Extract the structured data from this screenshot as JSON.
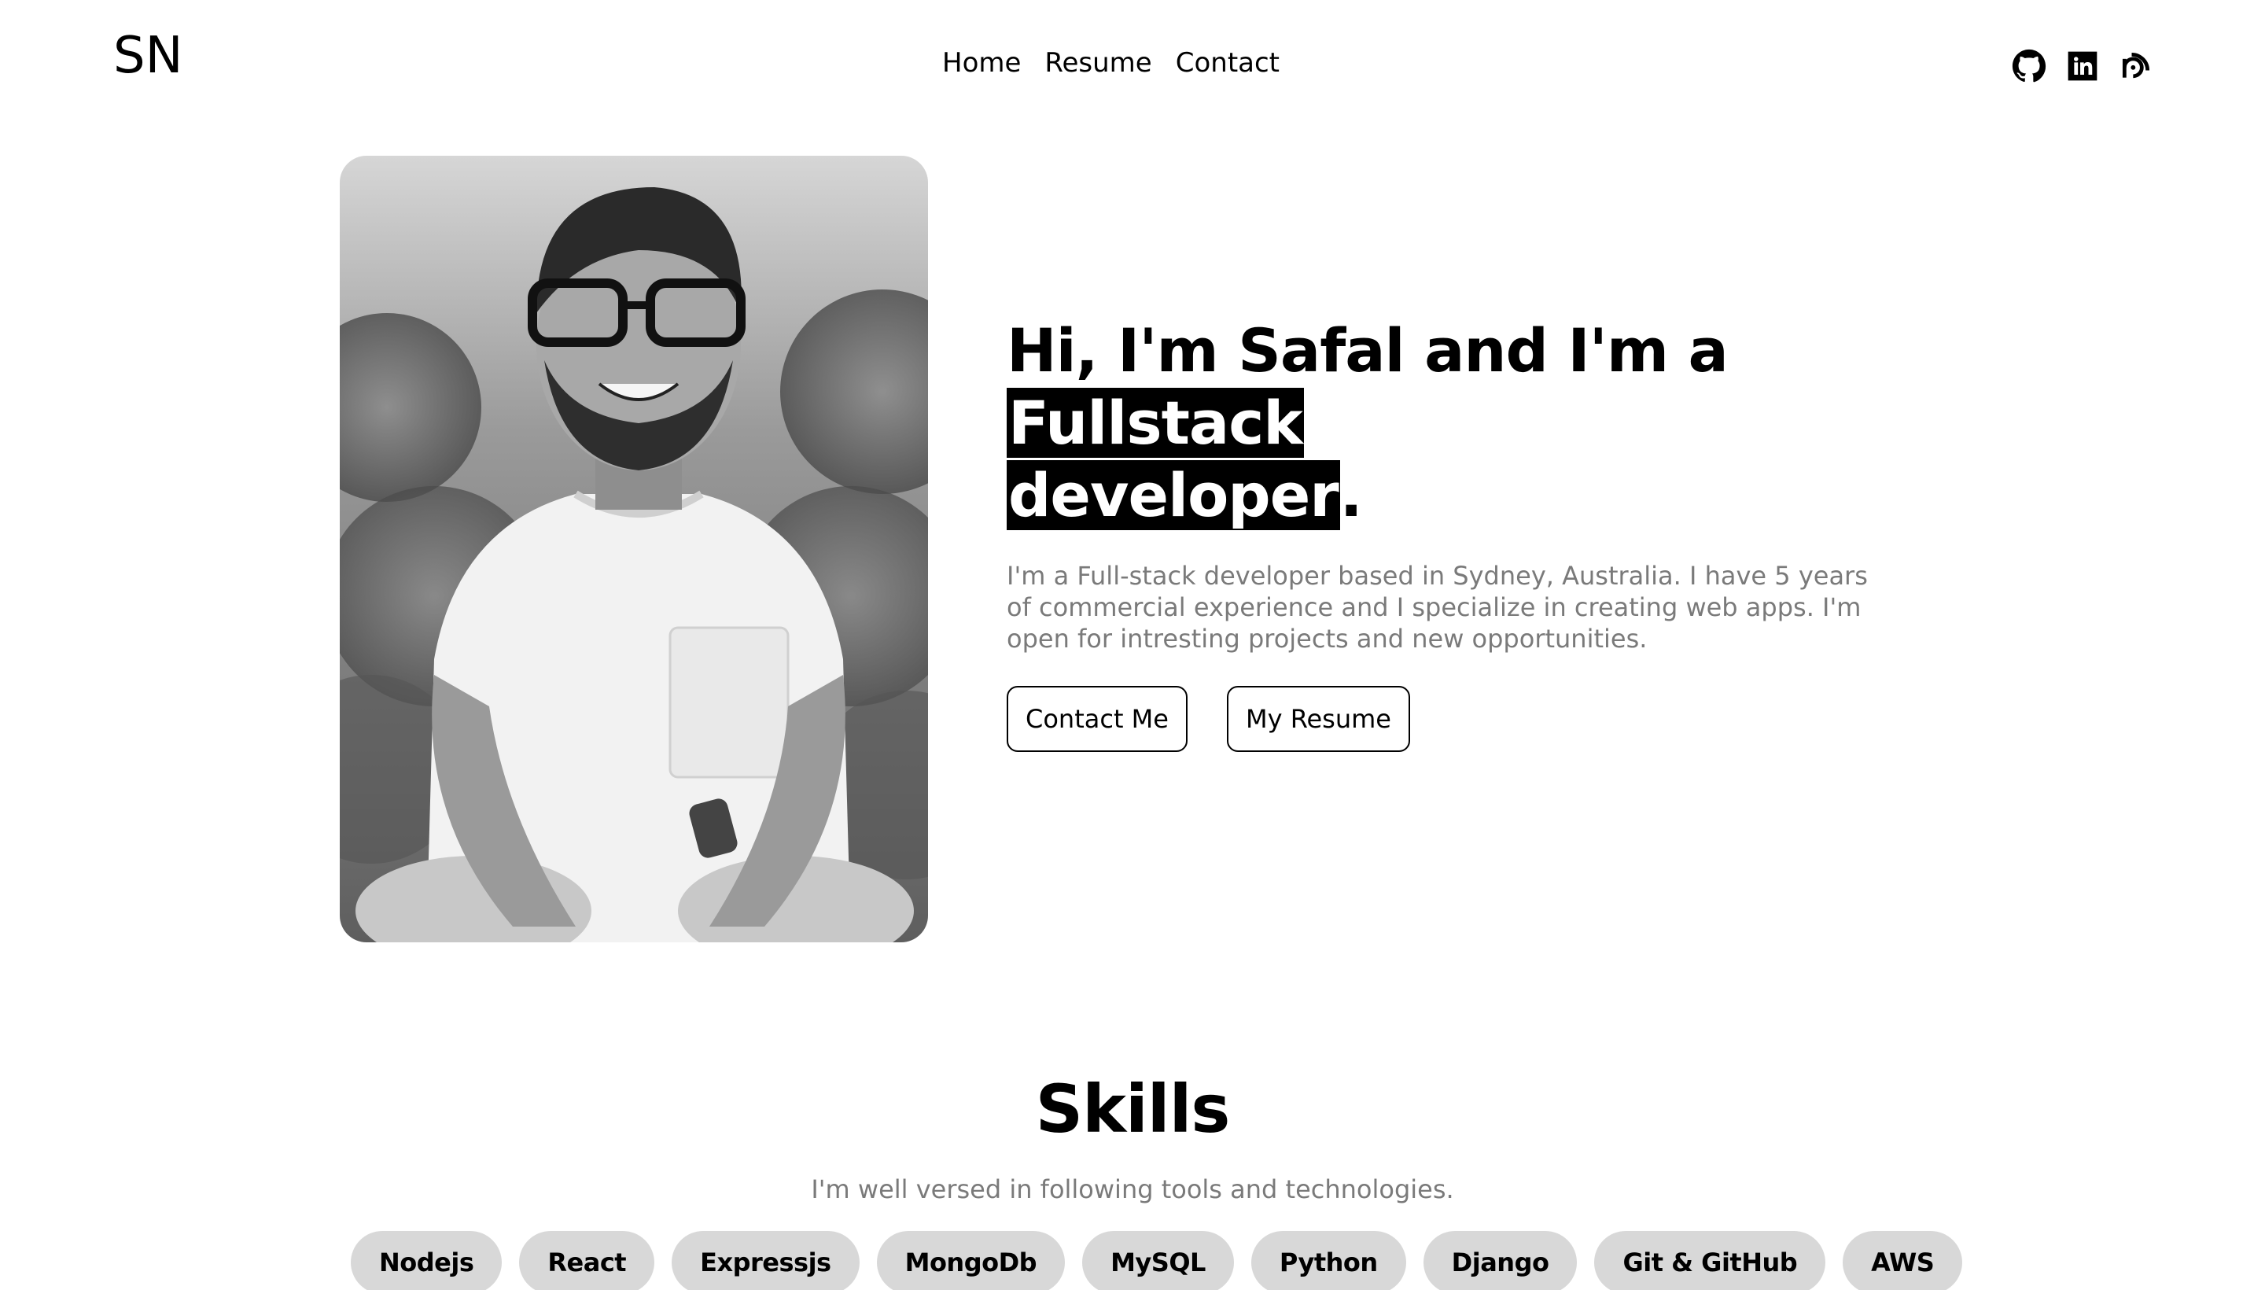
{
  "header": {
    "logo": "SN",
    "nav": [
      {
        "label": "Home"
      },
      {
        "label": "Resume"
      },
      {
        "label": "Contact"
      }
    ],
    "socials": [
      {
        "icon": "github-icon"
      },
      {
        "icon": "linkedin-icon"
      },
      {
        "icon": "blog-icon"
      }
    ]
  },
  "hero": {
    "headline_prefix": "Hi, I'm Safal and I'm a ",
    "headline_highlight_1": "Fullstack",
    "headline_highlight_2": "developer",
    "headline_suffix": ".",
    "bio": "I'm a Full-stack developer based in Sydney, Australia. I have 5 years of commercial experience and I specialize in creating web apps. I'm open for intresting projects and new opportunities.",
    "contact_button": "Contact Me",
    "resume_button": "My Resume"
  },
  "skills": {
    "title": "Skills",
    "subtitle": "I'm well versed in following tools and technologies.",
    "items": [
      "Nodejs",
      "React",
      "Expressjs",
      "MongoDb",
      "MySQL",
      "Python",
      "Django",
      "Git & GitHub",
      "AWS"
    ]
  },
  "colors": {
    "background": "#ffffff",
    "text": "#000000",
    "muted": "#7a7a7a",
    "chip": "#d8d8d8"
  }
}
